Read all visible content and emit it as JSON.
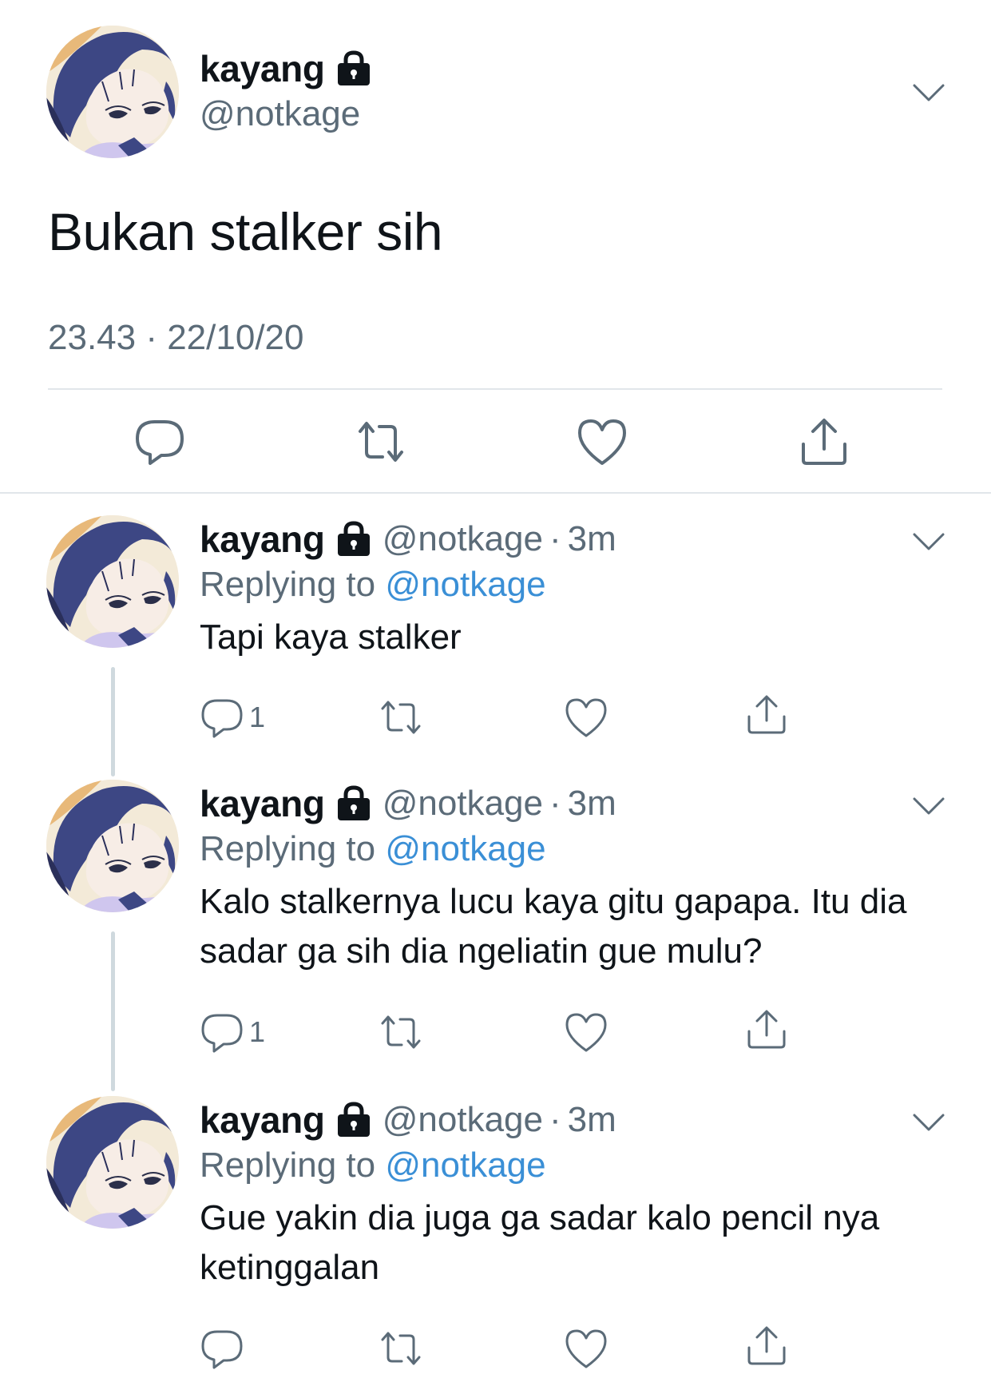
{
  "main_tweet": {
    "display_name": "kayang",
    "handle": "@notkage",
    "text": "Bukan stalker sih",
    "timestamp": "23.43 · 22/10/20",
    "actions": [
      "reply-icon",
      "retweet-icon",
      "like-icon",
      "share-icon"
    ]
  },
  "replies": [
    {
      "display_name": "kayang",
      "handle": "@notkage",
      "dot": "·",
      "time": "3m",
      "replying_prefix": "Replying to",
      "replying_to": "@notkage",
      "text": "Tapi kaya stalker",
      "reply_count": "1"
    },
    {
      "display_name": "kayang",
      "handle": "@notkage",
      "dot": "·",
      "time": "3m",
      "replying_prefix": "Replying to",
      "replying_to": "@notkage",
      "text": "Kalo stalkernya lucu kaya gitu gapapa. Itu dia sadar ga sih dia ngeliatin gue mulu?",
      "reply_count": "1"
    },
    {
      "display_name": "kayang",
      "handle": "@notkage",
      "dot": "·",
      "time": "3m",
      "replying_prefix": "Replying to",
      "replying_to": "@notkage",
      "text": "Gue yakin dia juga ga sadar kalo pencil nya ketinggalan",
      "reply_count": ""
    }
  ],
  "colors": {
    "text": "#0f1419",
    "secondary": "#5b6b78",
    "mention": "#3a8fd6",
    "divider": "#e1e6ea",
    "thread_line": "#cfd9de"
  }
}
